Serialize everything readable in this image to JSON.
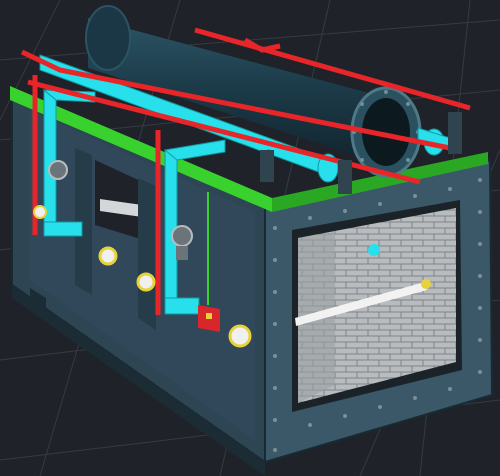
{
  "viewport": {
    "background": "#1f2329",
    "grid_color": "#3a4048"
  },
  "model": {
    "description_colors": {
      "steel_frame": "#3d5a68",
      "steel_frame_dark": "#24353e",
      "main_pipe": "#1d3b48",
      "cyan_pipe": "#27e0ec",
      "red_pipe": "#e8262a",
      "green_rail": "#38d12d",
      "firebrick": "#b9bdbf",
      "valve": "#6a7479",
      "burner_yellow": "#e7d23a"
    }
  },
  "icons": {
    "valve_left": "valve-icon",
    "valve_right": "valve-icon",
    "gauge": "gauge-icon",
    "switch": "switch-icon"
  }
}
